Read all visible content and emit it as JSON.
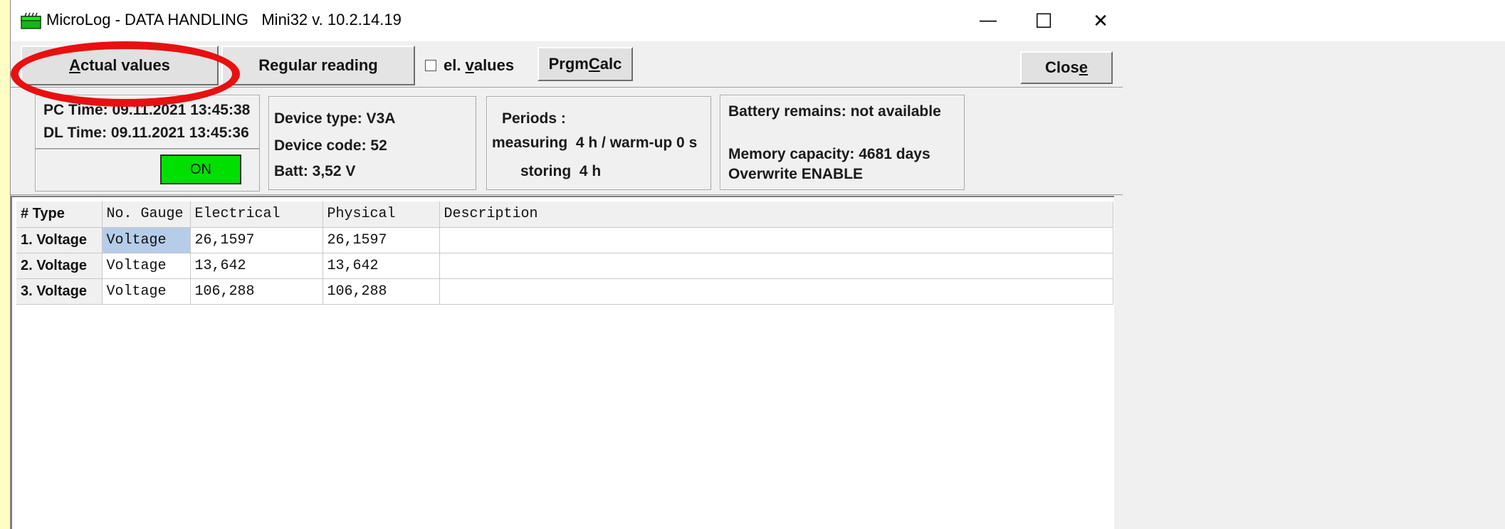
{
  "window": {
    "title": "MicroLog - DATA HANDLING   Mini32 v. 10.2.14.19",
    "icon": "green-folder-icon",
    "controls": {
      "minimize": "—",
      "maximize": "☐",
      "close": "✕"
    }
  },
  "toolbar": {
    "actual_values": {
      "pre": "",
      "key": "A",
      "post": "ctual values"
    },
    "regular_reading": {
      "pre": "Re",
      "key": "g",
      "post": "ular reading"
    },
    "el_values": {
      "pre": "el. ",
      "key": "v",
      "post": "alues",
      "checked": false
    },
    "prgm_calc": {
      "pre": "Prgm",
      "key": "C",
      "post": "alc"
    },
    "close": {
      "pre": "Clos",
      "key": "e",
      "post": ""
    }
  },
  "highlight": {
    "color": "#e81010",
    "target": "Actual values"
  },
  "status": {
    "pc_time": "PC Time: 09.11.2021 13:45:38",
    "dl_time": "DL Time: 09.11.2021 13:45:36",
    "indicator": "ON",
    "indicator_color": "#00e000",
    "device_type": "Device type: V3A",
    "device_code": "Device code: 52",
    "batt": "Batt: 3,52 V",
    "periods_title": "Periods :",
    "measuring": "measuring  4 h / warm-up 0 s",
    "storing": "storing  4 h",
    "battery_remains": "Battery remains: not available",
    "memory_capacity": "Memory capacity: 4681 days",
    "overwrite": "Overwrite ENABLE"
  },
  "grid": {
    "headers": [
      "# Type",
      "No. Gauge",
      "Electrical",
      "Physical",
      "Description"
    ],
    "rows": [
      {
        "type": "1. Voltage",
        "gauge": "Voltage",
        "electrical": "26,1597",
        "physical": "26,1597",
        "description": ""
      },
      {
        "type": "2. Voltage",
        "gauge": "Voltage",
        "electrical": "13,642",
        "physical": "13,642",
        "description": ""
      },
      {
        "type": "3. Voltage",
        "gauge": "Voltage",
        "electrical": "106,288",
        "physical": "106,288",
        "description": ""
      }
    ],
    "selection_color": "#b5cde9"
  }
}
